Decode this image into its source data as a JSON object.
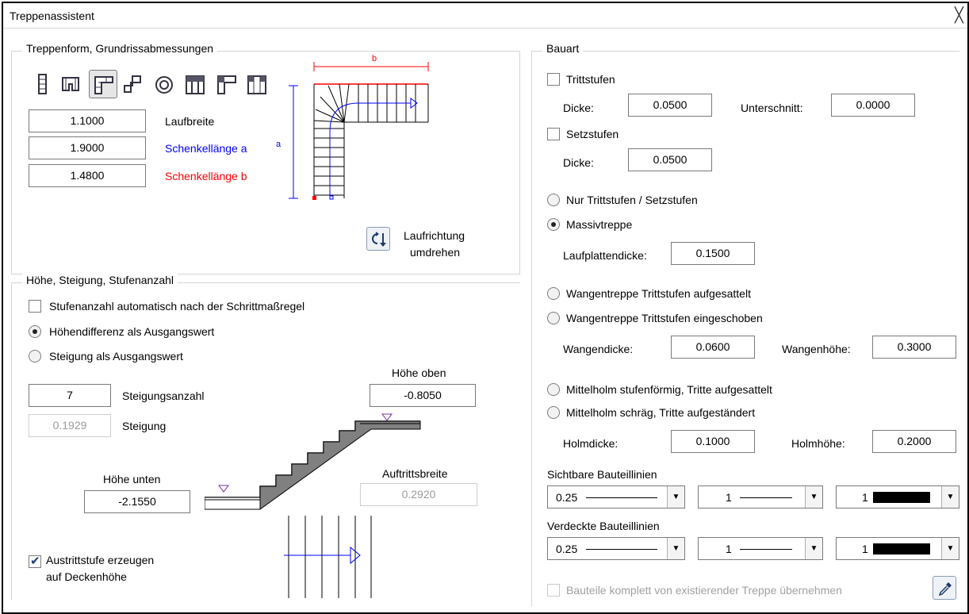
{
  "window": {
    "title": "Treppenassistent",
    "close_glyph": "╳"
  },
  "left": {
    "group1_title": "Treppenform, Grundrissabmessungen",
    "shape_icons": [
      "straight-stair-icon",
      "u-stair-icon",
      "l-stair-icon",
      "z-stair-icon",
      "spiral-stair-icon",
      "u-landing-stair-icon",
      "l-landing-stair-icon",
      "double-landing-stair-icon"
    ],
    "laufbreite": {
      "value": "1.1000",
      "label": "Laufbreite"
    },
    "schenkel_a": {
      "value": "1.9000",
      "label": "Schenkellänge a"
    },
    "schenkel_b": {
      "value": "1.4800",
      "label": "Schenkellänge b"
    },
    "dim_b": "b",
    "dim_a": "a",
    "reverse_label1": "Laufrichtung",
    "reverse_label2": "umdrehen",
    "group2_title": "Höhe, Steigung, Stufenanzahl",
    "auto_steps": "Stufenanzahl automatisch nach der Schrittmaßregel",
    "radio_height": "Höhendifferenz als Ausgangswert",
    "radio_rise": "Steigung als Ausgangswert",
    "hoehe_oben_label": "Höhe oben",
    "hoehe_oben": "-0.8050",
    "steigungsanzahl": "7",
    "steigungsanzahl_label": "Steigungsanzahl",
    "steigung": "0.1929",
    "steigung_label": "Steigung",
    "hoehe_unten_label": "Höhe unten",
    "hoehe_unten": "-2.1550",
    "auftrittsbreite_label": "Auftrittsbreite",
    "auftrittsbreite": "0.2920",
    "austritt1": "Austrittstufe  erzeugen",
    "austritt2": "auf Deckenhöhe"
  },
  "right": {
    "group_title": "Bauart",
    "trittstufen": "Trittstufen",
    "dicke_label": "Dicke:",
    "tritt_dicke": "0.0500",
    "unterschnitt_label": "Unterschnitt:",
    "unterschnitt": "0.0000",
    "setzstufen": "Setzstufen",
    "setz_dicke": "0.0500",
    "nur_tritt": "Nur Trittstufen / Setzstufen",
    "massiv": "Massivtreppe",
    "laufplatten_label": "Laufplattendicke:",
    "laufplatten": "0.1500",
    "wangen_auf": "Wangentreppe Trittstufen aufgesattelt",
    "wangen_ein": "Wangentreppe Trittstufen eingeschoben",
    "wangendicke_label": "Wangendicke:",
    "wangendicke": "0.0600",
    "wangenhoehe_label": "Wangenhöhe:",
    "wangenhoehe": "0.3000",
    "mittel_stufen": "Mittelholm stufenförmig, Tritte aufgesattelt",
    "mittel_schraeg": "Mittelholm schräg, Tritte aufgeständert",
    "holmdicke_label": "Holmdicke:",
    "holmdicke": "0.1000",
    "holmhoehe_label": "Holmhöhe:",
    "holmhoehe": "0.2000",
    "sichtbar_label": "Sichtbare Bauteillinien",
    "verdeckt_label": "Verdeckte Bauteillinien",
    "pen": "0.25",
    "line": "1",
    "color": "1",
    "bauteile": "Bauteile komplett von existierender Treppe übernehmen"
  },
  "colors": {
    "blue": "#0000ff",
    "red": "#ff0000",
    "navy": "#1f3b6b"
  }
}
